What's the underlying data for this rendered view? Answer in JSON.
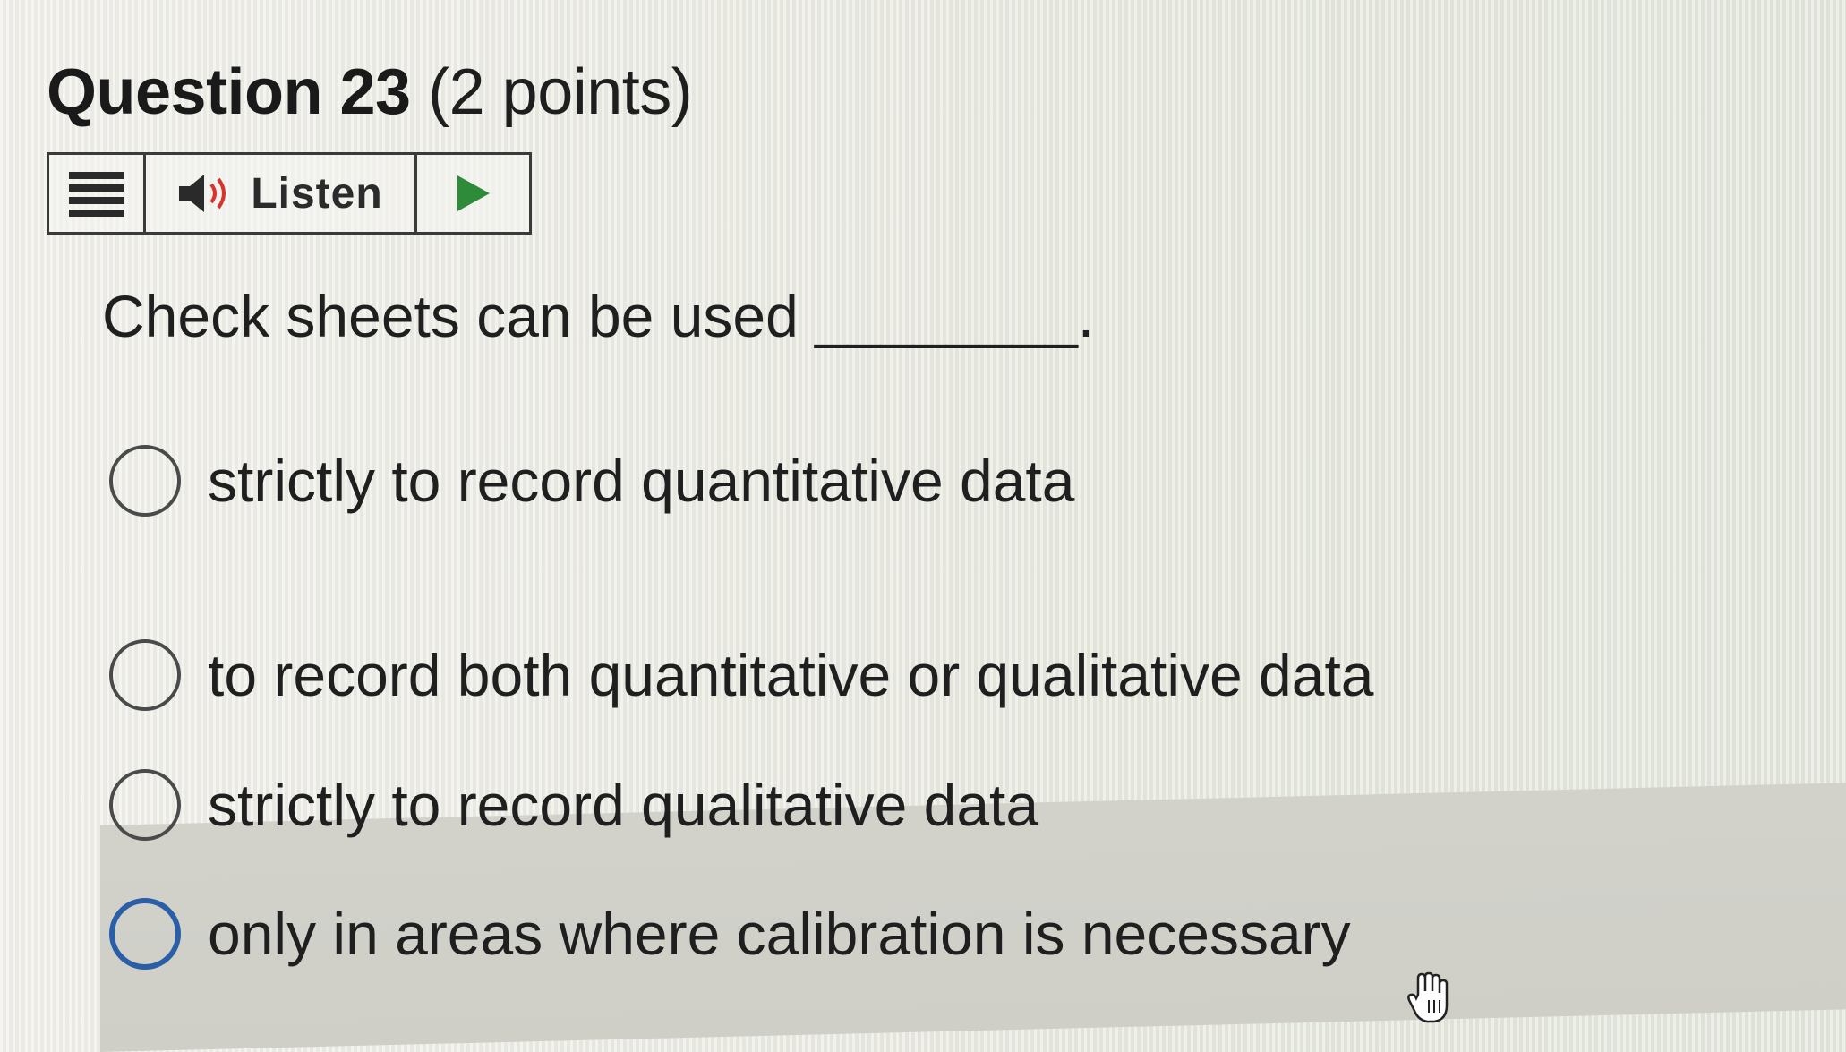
{
  "question": {
    "number_label": "Question 23",
    "points_label": "(2 points)"
  },
  "toolbar": {
    "menu_icon": "menu-lines-icon",
    "speaker_icon": "speaker-icon",
    "listen_label": "Listen",
    "play_icon": "play-icon",
    "play_color": "#2e8b3a"
  },
  "prompt": {
    "text": "Check sheets can be used ________."
  },
  "options": [
    {
      "label": "strictly to record quantitative data"
    },
    {
      "label": "to record both quantitative or qualitative data"
    },
    {
      "label": "strictly to record qualitative data"
    },
    {
      "label": "only in areas where calibration is necessary"
    }
  ],
  "colors": {
    "focus_ring": "#2a5fa8",
    "hover_highlight": "#d0d0c9"
  },
  "cursor_icon": "hand-pointer-icon"
}
